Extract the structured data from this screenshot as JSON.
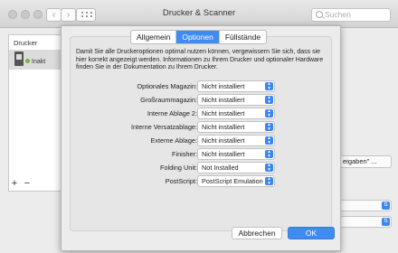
{
  "window": {
    "title": "Drucker & Scanner"
  },
  "toolbar": {
    "back_glyph": "‹",
    "forward_glyph": "›",
    "search_placeholder": "Suchen"
  },
  "sidebar": {
    "header": "Drucker",
    "printer_status": "Inakt",
    "add_glyph": "+",
    "remove_glyph": "−"
  },
  "background": {
    "share_button_label": "eigaben\" ..."
  },
  "sheet": {
    "tabs": [
      {
        "label": "Allgemein",
        "active": false
      },
      {
        "label": "Optionen",
        "active": true
      },
      {
        "label": "Füllstände",
        "active": false
      }
    ],
    "intro": "Damit Sie alle Druckeroptionen optimal nutzen können, vergewissern Sie sich, dass sie hier korrekt angezeigt werden. Informationen zu Ihrem Drucker und optionaler Hardware finden Sie in der Dokumentation zu Ihrem Drucker.",
    "options": [
      {
        "label": "Optionales Magazin:",
        "value": "Nicht installiert"
      },
      {
        "label": "Großraummagazin:",
        "value": "Nicht installiert"
      },
      {
        "label": "Interne Ablage 2:",
        "value": "Nicht installiert"
      },
      {
        "label": "Interne Versatzablage:",
        "value": "Nicht installiert"
      },
      {
        "label": "Externe Ablage:",
        "value": "Nicht installiert"
      },
      {
        "label": "Finisher:",
        "value": "Nicht installiert"
      },
      {
        "label": "Folding Unit:",
        "value": "Not Installed"
      },
      {
        "label": "PostScript:",
        "value": "PostScript Emulation"
      }
    ],
    "cancel_label": "Abbrechen",
    "ok_label": "OK"
  },
  "colors": {
    "accent": "#3f8cf0"
  }
}
